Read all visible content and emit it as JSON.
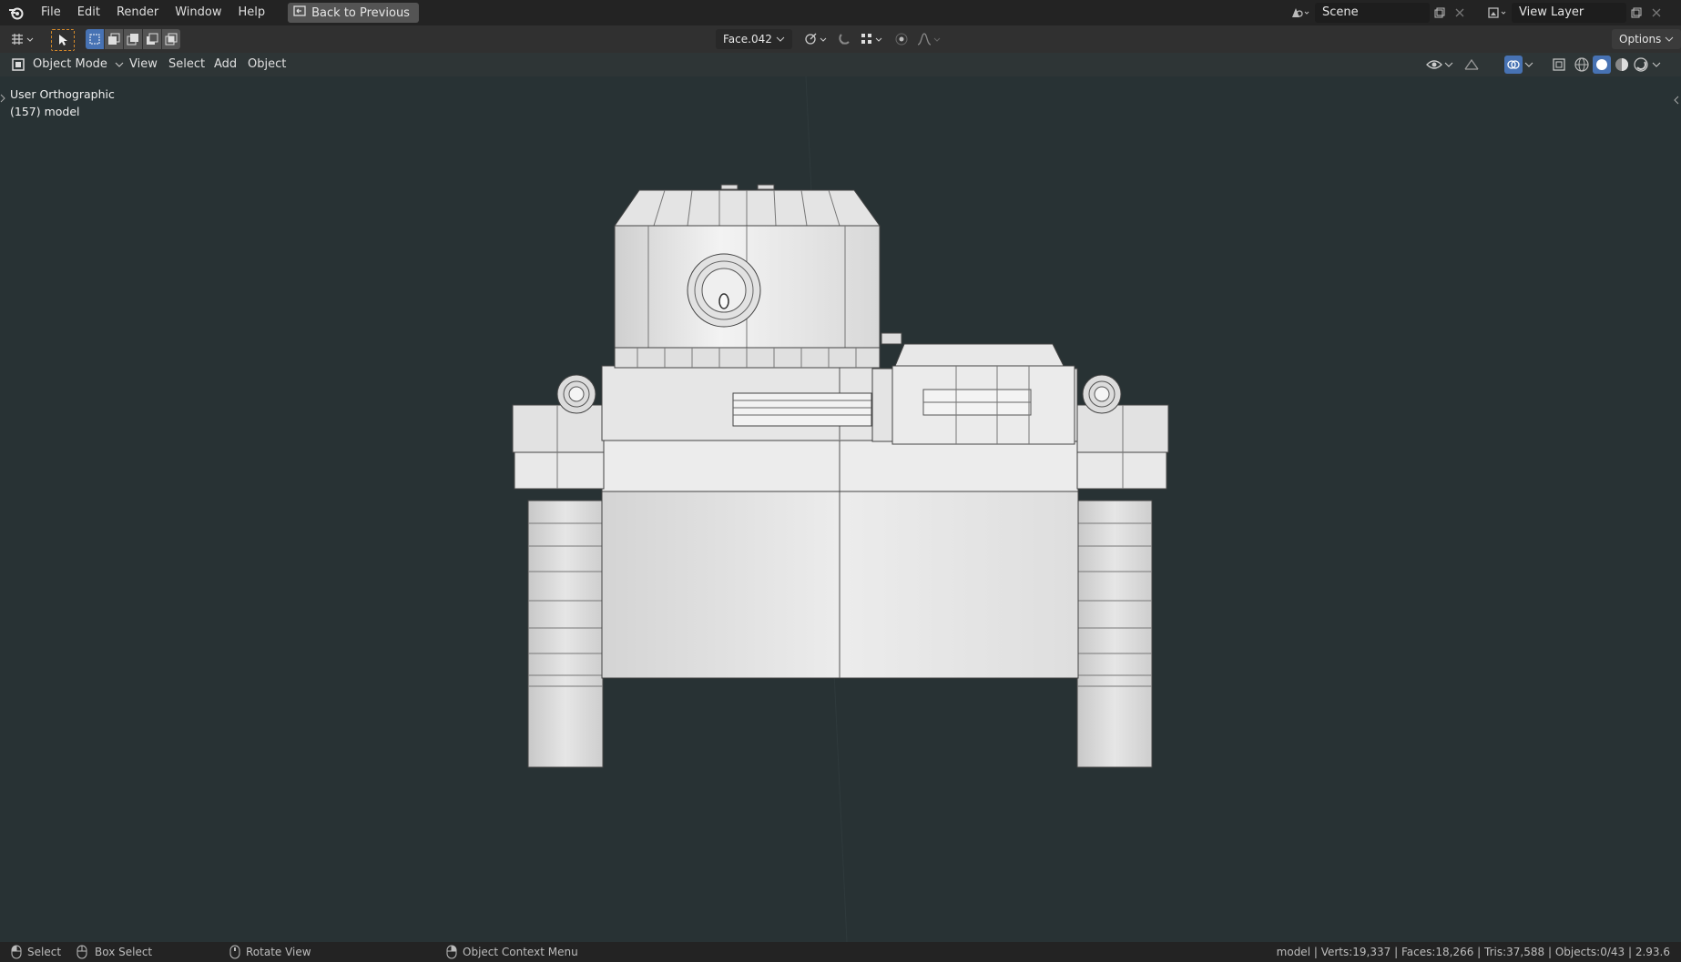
{
  "menu": {
    "file": "File",
    "edit": "Edit",
    "render": "Render",
    "window": "Window",
    "help": "Help",
    "back_to_previous": "Back to Previous"
  },
  "scene": {
    "label": "Scene",
    "view_layer": "View Layer"
  },
  "toolbar": {
    "face_selector": "Face.042",
    "options": "Options"
  },
  "header": {
    "mode": "Object Mode",
    "view": "View",
    "select": "Select",
    "add": "Add",
    "object": "Object"
  },
  "viewport": {
    "projection": "User Orthographic",
    "object_info": "(157) model"
  },
  "status": {
    "select": "Select",
    "box_select": "Box Select",
    "rotate_view": "Rotate View",
    "context_menu": "Object Context Menu",
    "stats": "model | Verts:19,337 | Faces:18,266 | Tris:37,588 | Objects:0/43 | 2.93.6"
  },
  "colors": {
    "viewport_bg": "#283234",
    "topbar_bg": "#232323",
    "toolbar_bg": "#303030",
    "accent_blue": "#4772b3",
    "model_light": "#e8e8e8",
    "wire": "#3a3a3a"
  }
}
